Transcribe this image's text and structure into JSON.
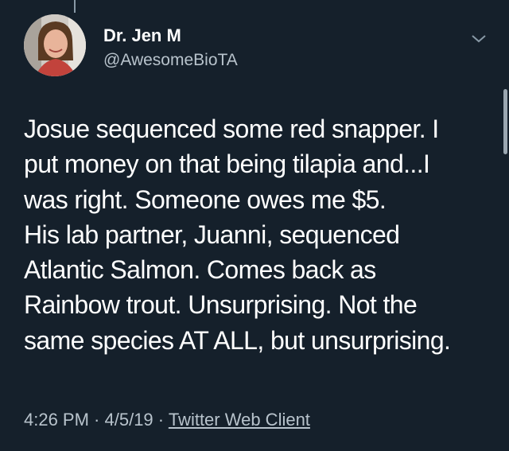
{
  "author": {
    "display_name": "Dr. Jen M",
    "handle": "@AwesomeBioTA"
  },
  "tweet": {
    "lines": [
      "Josue sequenced some red snapper. I",
      "put money on that being tilapia and...I",
      "was right. Someone owes me $5.",
      "His lab partner, Juanni, sequenced",
      "Atlantic Salmon. Comes back as",
      "Rainbow trout. Unsurprising. Not the",
      "same species AT ALL, but unsurprising."
    ]
  },
  "meta": {
    "time": "4:26 PM",
    "separator1": " · ",
    "date": "4/5/19",
    "separator2": " · ",
    "source": "Twitter Web Client"
  },
  "icons": {
    "menu": "chevron-down-icon"
  },
  "colors": {
    "background": "#15202b",
    "text": "#ffffff",
    "secondary_text": "#b8c3cc"
  }
}
